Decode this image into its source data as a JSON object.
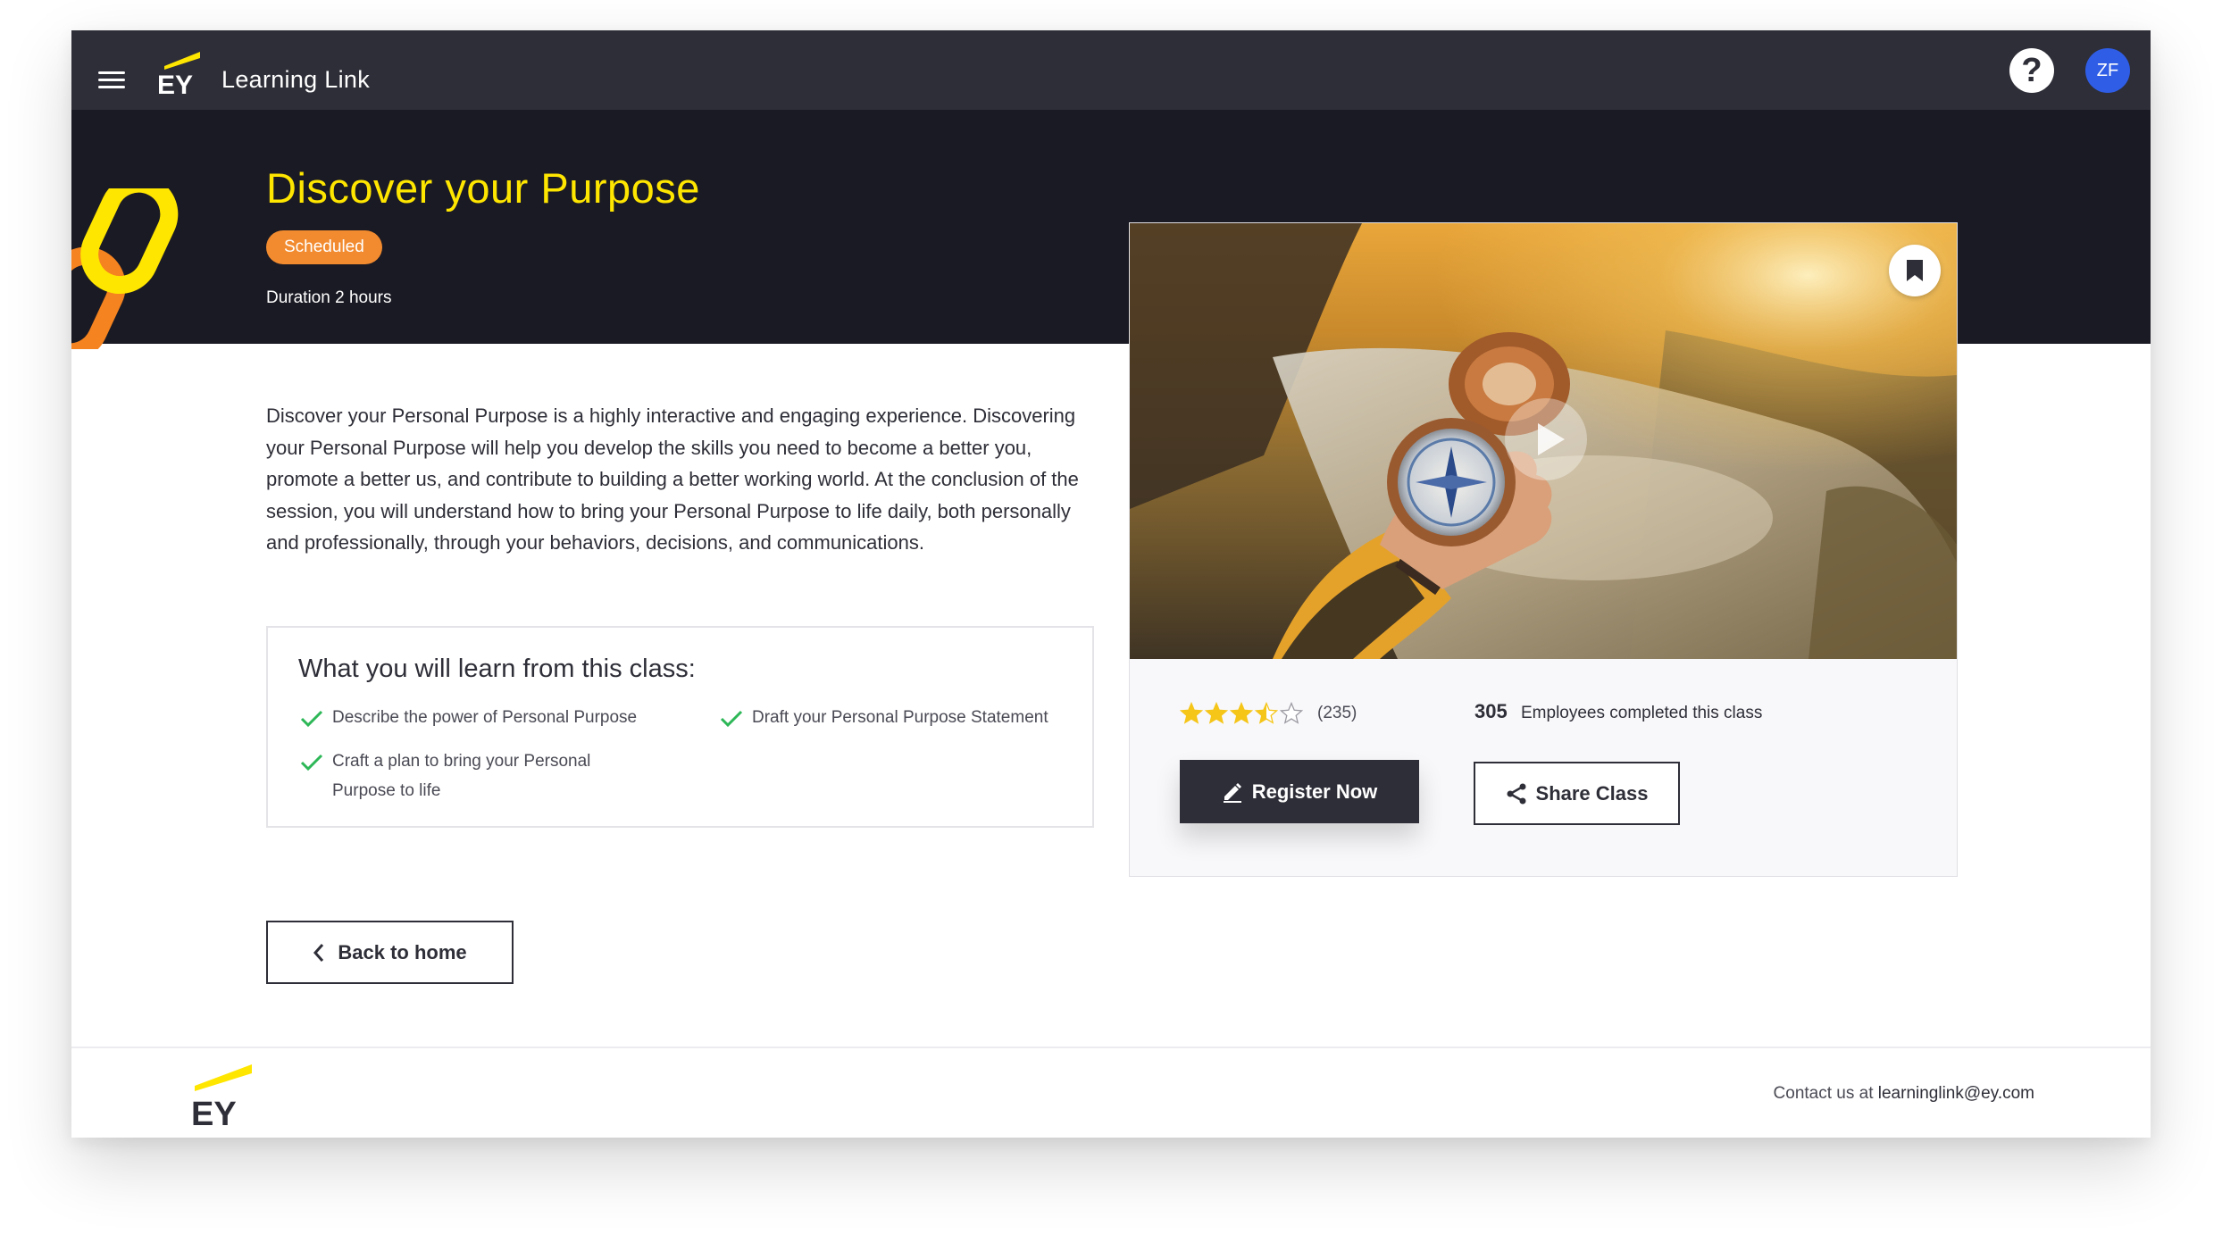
{
  "header": {
    "logo_text": "EY",
    "app_title": "Learning Link",
    "help_symbol": "?",
    "avatar_initials": "ZF"
  },
  "course": {
    "title": "Discover your Purpose",
    "status": "Scheduled",
    "duration": "Duration 2 hours",
    "description": "Discover your Personal Purpose is a highly interactive and engaging experience. Discovering your Personal Purpose will help you develop the skills you need to become a better you, promote a better us, and contribute to building a better working world. At the conclusion of the session, you will understand how to bring your Personal Purpose to life daily, both personally and professionally, through your behaviors, decisions, and communications."
  },
  "learn": {
    "heading": "What you will learn from this class:",
    "items": [
      "Describe the power of Personal Purpose",
      "Draft your Personal Purpose Statement",
      "Craft a plan to bring your Personal Purpose to life"
    ]
  },
  "card": {
    "rating": 3.5,
    "rating_max": 5,
    "rating_count": "(235)",
    "completed_count": "305",
    "completed_label": "Employees completed this class",
    "register_label": "Register Now",
    "share_label": "Share Class"
  },
  "nav": {
    "back_label": "Back to home"
  },
  "footer": {
    "logo_text": "EY",
    "contact_prefix": "Contact us at",
    "contact_email": "learninglink@ey.com"
  },
  "colors": {
    "brand_yellow": "#ffe600",
    "header_bg": "#2e2e38",
    "hero_bg": "#1a1a24",
    "badge_orange": "#f28b2f",
    "avatar_blue": "#2f5de6",
    "check_green": "#2db757",
    "star_yellow": "#f5c518"
  },
  "icons": {
    "menu": "hamburger-menu-icon",
    "help": "help-icon",
    "bookmark": "bookmark-icon",
    "play": "play-icon",
    "edit": "pencil-icon",
    "share": "share-icon",
    "back": "chevron-left-icon",
    "check": "checkmark-icon"
  }
}
